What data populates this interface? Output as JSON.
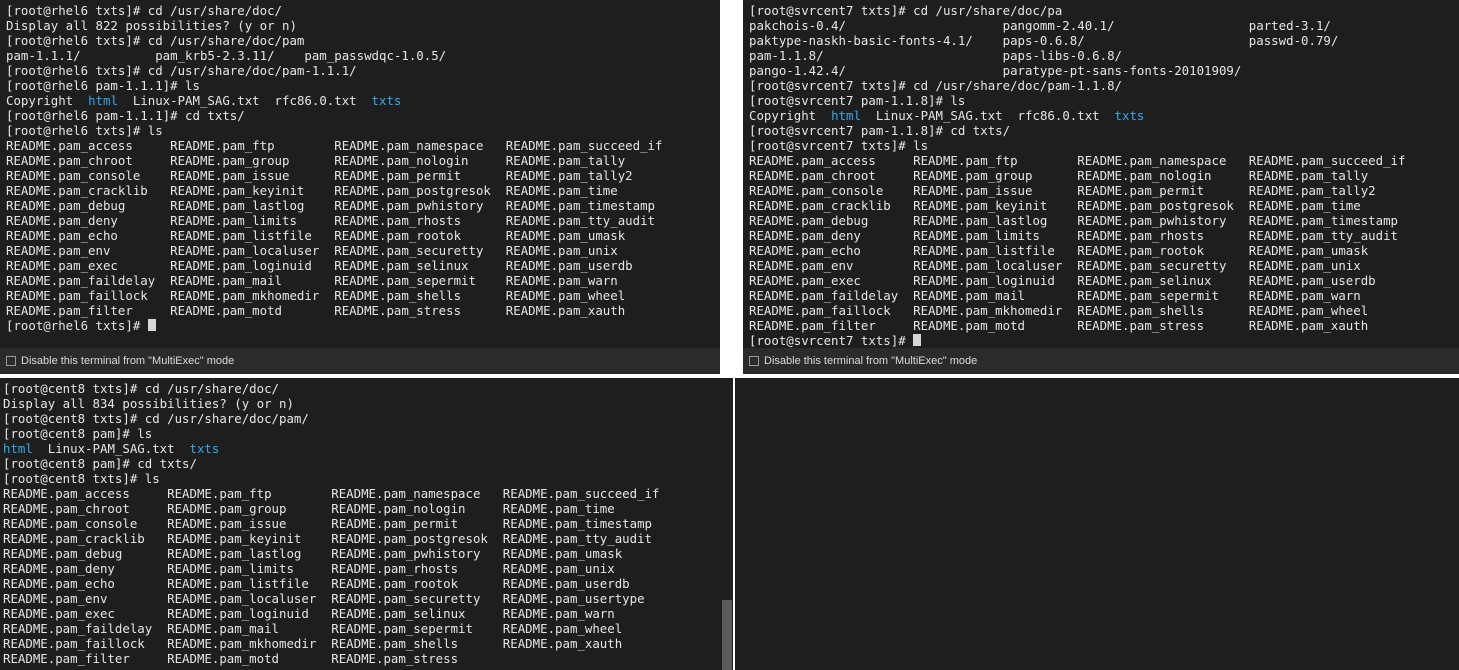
{
  "multiexec_label": "Disable this terminal from \"MultiExec\" mode",
  "panes": {
    "rhel6": {
      "lines": [
        [
          {
            "t": "[root@rhel6 txts]# cd /usr/share/doc/"
          }
        ],
        [
          {
            "t": "Display all 822 possibilities? (y or n)"
          }
        ],
        [
          {
            "t": "[root@rhel6 txts]# cd /usr/share/doc/pam"
          }
        ],
        [
          {
            "t": "pam-1.1.1/          pam_krb5-2.3.11/    pam_passwdqc-1.0.5/"
          }
        ],
        [
          {
            "t": "[root@rhel6 txts]# cd /usr/share/doc/pam-1.1.1/"
          }
        ],
        [
          {
            "t": "[root@rhel6 pam-1.1.1]# ls"
          }
        ],
        [
          {
            "t": "Copyright  "
          },
          {
            "t": "html",
            "c": "dir"
          },
          {
            "t": "  Linux-PAM_SAG.txt  rfc86.0.txt  "
          },
          {
            "t": "txts",
            "c": "dir"
          }
        ],
        [
          {
            "t": "[root@rhel6 pam-1.1.1]# cd txts/"
          }
        ],
        [
          {
            "t": "[root@rhel6 txts]# ls"
          }
        ],
        [
          {
            "t": "README.pam_access     README.pam_ftp        README.pam_namespace   README.pam_succeed_if"
          }
        ],
        [
          {
            "t": "README.pam_chroot     README.pam_group      README.pam_nologin     README.pam_tally"
          }
        ],
        [
          {
            "t": "README.pam_console    README.pam_issue      README.pam_permit      README.pam_tally2"
          }
        ],
        [
          {
            "t": "README.pam_cracklib   README.pam_keyinit    README.pam_postgresok  README.pam_time"
          }
        ],
        [
          {
            "t": "README.pam_debug      README.pam_lastlog    README.pam_pwhistory   README.pam_timestamp"
          }
        ],
        [
          {
            "t": "README.pam_deny       README.pam_limits     README.pam_rhosts      README.pam_tty_audit"
          }
        ],
        [
          {
            "t": "README.pam_echo       README.pam_listfile   README.pam_rootok      README.pam_umask"
          }
        ],
        [
          {
            "t": "README.pam_env        README.pam_localuser  README.pam_securetty   README.pam_unix"
          }
        ],
        [
          {
            "t": "README.pam_exec       README.pam_loginuid   README.pam_selinux     README.pam_userdb"
          }
        ],
        [
          {
            "t": "README.pam_faildelay  README.pam_mail       README.pam_sepermit    README.pam_warn"
          }
        ],
        [
          {
            "t": "README.pam_faillock   README.pam_mkhomedir  README.pam_shells      README.pam_wheel"
          }
        ],
        [
          {
            "t": "README.pam_filter     README.pam_motd       README.pam_stress      README.pam_xauth"
          }
        ],
        [
          {
            "t": "[root@rhel6 txts]# "
          },
          {
            "cursor": true
          }
        ]
      ]
    },
    "svrcent7": {
      "lines": [
        [
          {
            "t": "[root@svrcent7 txts]# cd /usr/share/doc/pa"
          }
        ],
        [
          {
            "t": "pakchois-0.4/                     pangomm-2.40.1/                  parted-3.1/"
          }
        ],
        [
          {
            "t": "paktype-naskh-basic-fonts-4.1/    paps-0.6.8/                      passwd-0.79/"
          }
        ],
        [
          {
            "t": "pam-1.1.8/                        paps-libs-0.6.8/"
          }
        ],
        [
          {
            "t": "pango-1.42.4/                     paratype-pt-sans-fonts-20101909/"
          }
        ],
        [
          {
            "t": "[root@svrcent7 txts]# cd /usr/share/doc/pam-1.1.8/"
          }
        ],
        [
          {
            "t": "[root@svrcent7 pam-1.1.8]# ls"
          }
        ],
        [
          {
            "t": "Copyright  "
          },
          {
            "t": "html",
            "c": "dir"
          },
          {
            "t": "  Linux-PAM_SAG.txt  rfc86.0.txt  "
          },
          {
            "t": "txts",
            "c": "dir"
          }
        ],
        [
          {
            "t": "[root@svrcent7 pam-1.1.8]# cd txts/"
          }
        ],
        [
          {
            "t": "[root@svrcent7 txts]# ls"
          }
        ],
        [
          {
            "t": "README.pam_access     README.pam_ftp        README.pam_namespace   README.pam_succeed_if"
          }
        ],
        [
          {
            "t": "README.pam_chroot     README.pam_group      README.pam_nologin     README.pam_tally"
          }
        ],
        [
          {
            "t": "README.pam_console    README.pam_issue      README.pam_permit      README.pam_tally2"
          }
        ],
        [
          {
            "t": "README.pam_cracklib   README.pam_keyinit    README.pam_postgresok  README.pam_time"
          }
        ],
        [
          {
            "t": "README.pam_debug      README.pam_lastlog    README.pam_pwhistory   README.pam_timestamp"
          }
        ],
        [
          {
            "t": "README.pam_deny       README.pam_limits     README.pam_rhosts      README.pam_tty_audit"
          }
        ],
        [
          {
            "t": "README.pam_echo       README.pam_listfile   README.pam_rootok      README.pam_umask"
          }
        ],
        [
          {
            "t": "README.pam_env        README.pam_localuser  README.pam_securetty   README.pam_unix"
          }
        ],
        [
          {
            "t": "README.pam_exec       README.pam_loginuid   README.pam_selinux     README.pam_userdb"
          }
        ],
        [
          {
            "t": "README.pam_faildelay  README.pam_mail       README.pam_sepermit    README.pam_warn"
          }
        ],
        [
          {
            "t": "README.pam_faillock   README.pam_mkhomedir  README.pam_shells      README.pam_wheel"
          }
        ],
        [
          {
            "t": "README.pam_filter     README.pam_motd       README.pam_stress      README.pam_xauth"
          }
        ],
        [
          {
            "t": "[root@svrcent7 txts]# "
          },
          {
            "cursor": true
          }
        ]
      ]
    },
    "cent8": {
      "lines": [
        [
          {
            "t": "[root@cent8 txts]# cd /usr/share/doc/"
          }
        ],
        [
          {
            "t": "Display all 834 possibilities? (y or n)"
          }
        ],
        [
          {
            "t": "[root@cent8 txts]# cd /usr/share/doc/pam/"
          }
        ],
        [
          {
            "t": "[root@cent8 pam]# ls"
          }
        ],
        [
          {
            "t": "html",
            "c": "dir"
          },
          {
            "t": "  Linux-PAM_SAG.txt  "
          },
          {
            "t": "txts",
            "c": "dir"
          }
        ],
        [
          {
            "t": "[root@cent8 pam]# cd txts/"
          }
        ],
        [
          {
            "t": "[root@cent8 txts]# ls"
          }
        ],
        [
          {
            "t": "README.pam_access     README.pam_ftp        README.pam_namespace   README.pam_succeed_if"
          }
        ],
        [
          {
            "t": "README.pam_chroot     README.pam_group      README.pam_nologin     README.pam_time"
          }
        ],
        [
          {
            "t": "README.pam_console    README.pam_issue      README.pam_permit      README.pam_timestamp"
          }
        ],
        [
          {
            "t": "README.pam_cracklib   README.pam_keyinit    README.pam_postgresok  README.pam_tty_audit"
          }
        ],
        [
          {
            "t": "README.pam_debug      README.pam_lastlog    README.pam_pwhistory   README.pam_umask"
          }
        ],
        [
          {
            "t": "README.pam_deny       README.pam_limits     README.pam_rhosts      README.pam_unix"
          }
        ],
        [
          {
            "t": "README.pam_echo       README.pam_listfile   README.pam_rootok      README.pam_userdb"
          }
        ],
        [
          {
            "t": "README.pam_env        README.pam_localuser  README.pam_securetty   README.pam_usertype"
          }
        ],
        [
          {
            "t": "README.pam_exec       README.pam_loginuid   README.pam_selinux     README.pam_warn"
          }
        ],
        [
          {
            "t": "README.pam_faildelay  README.pam_mail       README.pam_sepermit    README.pam_wheel"
          }
        ],
        [
          {
            "t": "README.pam_faillock   README.pam_mkhomedir  README.pam_shells      README.pam_xauth"
          }
        ],
        [
          {
            "t": "README.pam_filter     README.pam_motd       README.pam_stress"
          }
        ]
      ]
    },
    "empty": {
      "lines": []
    }
  }
}
